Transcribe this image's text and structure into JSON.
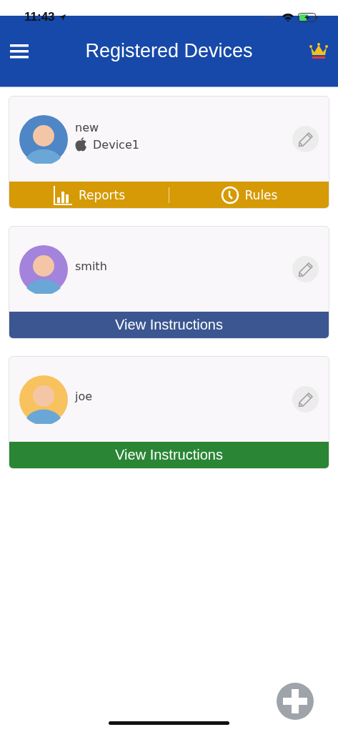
{
  "status_bar": {
    "time": "11:43"
  },
  "header": {
    "title": "Registered Devices"
  },
  "devices": [
    {
      "name": "new",
      "device": "Device1",
      "footer": {
        "kind": "actions",
        "color": "#d59a06",
        "actions": [
          {
            "label": "Reports",
            "kind": "chart"
          },
          {
            "label": "Rules",
            "kind": "clock"
          }
        ]
      }
    },
    {
      "name": "smith",
      "footer": {
        "kind": "button",
        "color": "#3b5690",
        "label": "View Instructions"
      }
    },
    {
      "name": "joe",
      "footer": {
        "kind": "button",
        "color": "#2a8535",
        "label": "View Instructions"
      }
    }
  ]
}
